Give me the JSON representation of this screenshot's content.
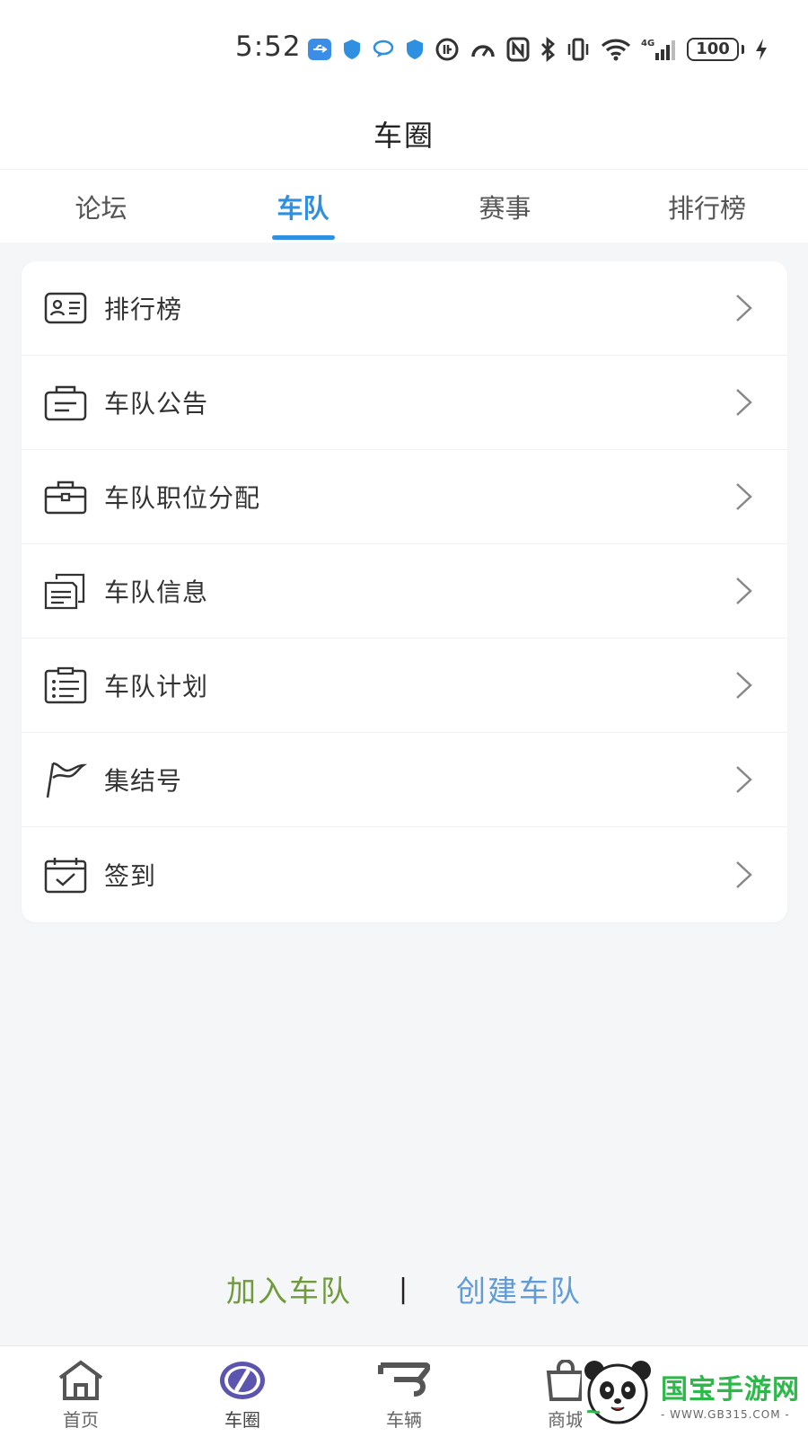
{
  "status_bar": {
    "time": "5:52",
    "signal_label": "4G",
    "battery": "100",
    "icons": [
      "usb-icon",
      "shield-icon",
      "chat-icon",
      "shield-icon",
      "data-saver-icon",
      "speed-icon",
      "nfc-icon",
      "bluetooth-icon",
      "vibrate-icon",
      "wifi-icon",
      "cellular-signal-icon",
      "battery-icon",
      "charging-icon"
    ]
  },
  "header": {
    "title": "车圈"
  },
  "tabs": [
    {
      "label": "论坛",
      "active": false
    },
    {
      "label": "车队",
      "active": true
    },
    {
      "label": "赛事",
      "active": false
    },
    {
      "label": "排行榜",
      "active": false
    }
  ],
  "menu": [
    {
      "label": "排行榜",
      "icon": "id-card-icon"
    },
    {
      "label": "车队公告",
      "icon": "announcement-folder-icon"
    },
    {
      "label": "车队职位分配",
      "icon": "briefcase-icon"
    },
    {
      "label": "车队信息",
      "icon": "documents-icon"
    },
    {
      "label": "车队计划",
      "icon": "clipboard-list-icon"
    },
    {
      "label": "集结号",
      "icon": "flag-icon"
    },
    {
      "label": "签到",
      "icon": "calendar-check-icon"
    }
  ],
  "actions": {
    "join": "加入车队",
    "separator": "|",
    "create": "创建车队"
  },
  "bottom_nav": [
    {
      "label": "首页",
      "icon": "home-icon",
      "active": false
    },
    {
      "label": "车圈",
      "icon": "compass-icon",
      "active": true
    },
    {
      "label": "车辆",
      "icon": "car-icon",
      "active": false
    },
    {
      "label": "商城",
      "icon": "shopping-bag-icon",
      "active": false
    }
  ],
  "watermark": {
    "title": "国宝手游网",
    "subtitle": "- WWW.GB315.COM -"
  },
  "colors": {
    "accent": "#2f8fe0",
    "join": "#6f9b3a",
    "create": "#5f9bd6",
    "background": "#f5f6f8"
  }
}
